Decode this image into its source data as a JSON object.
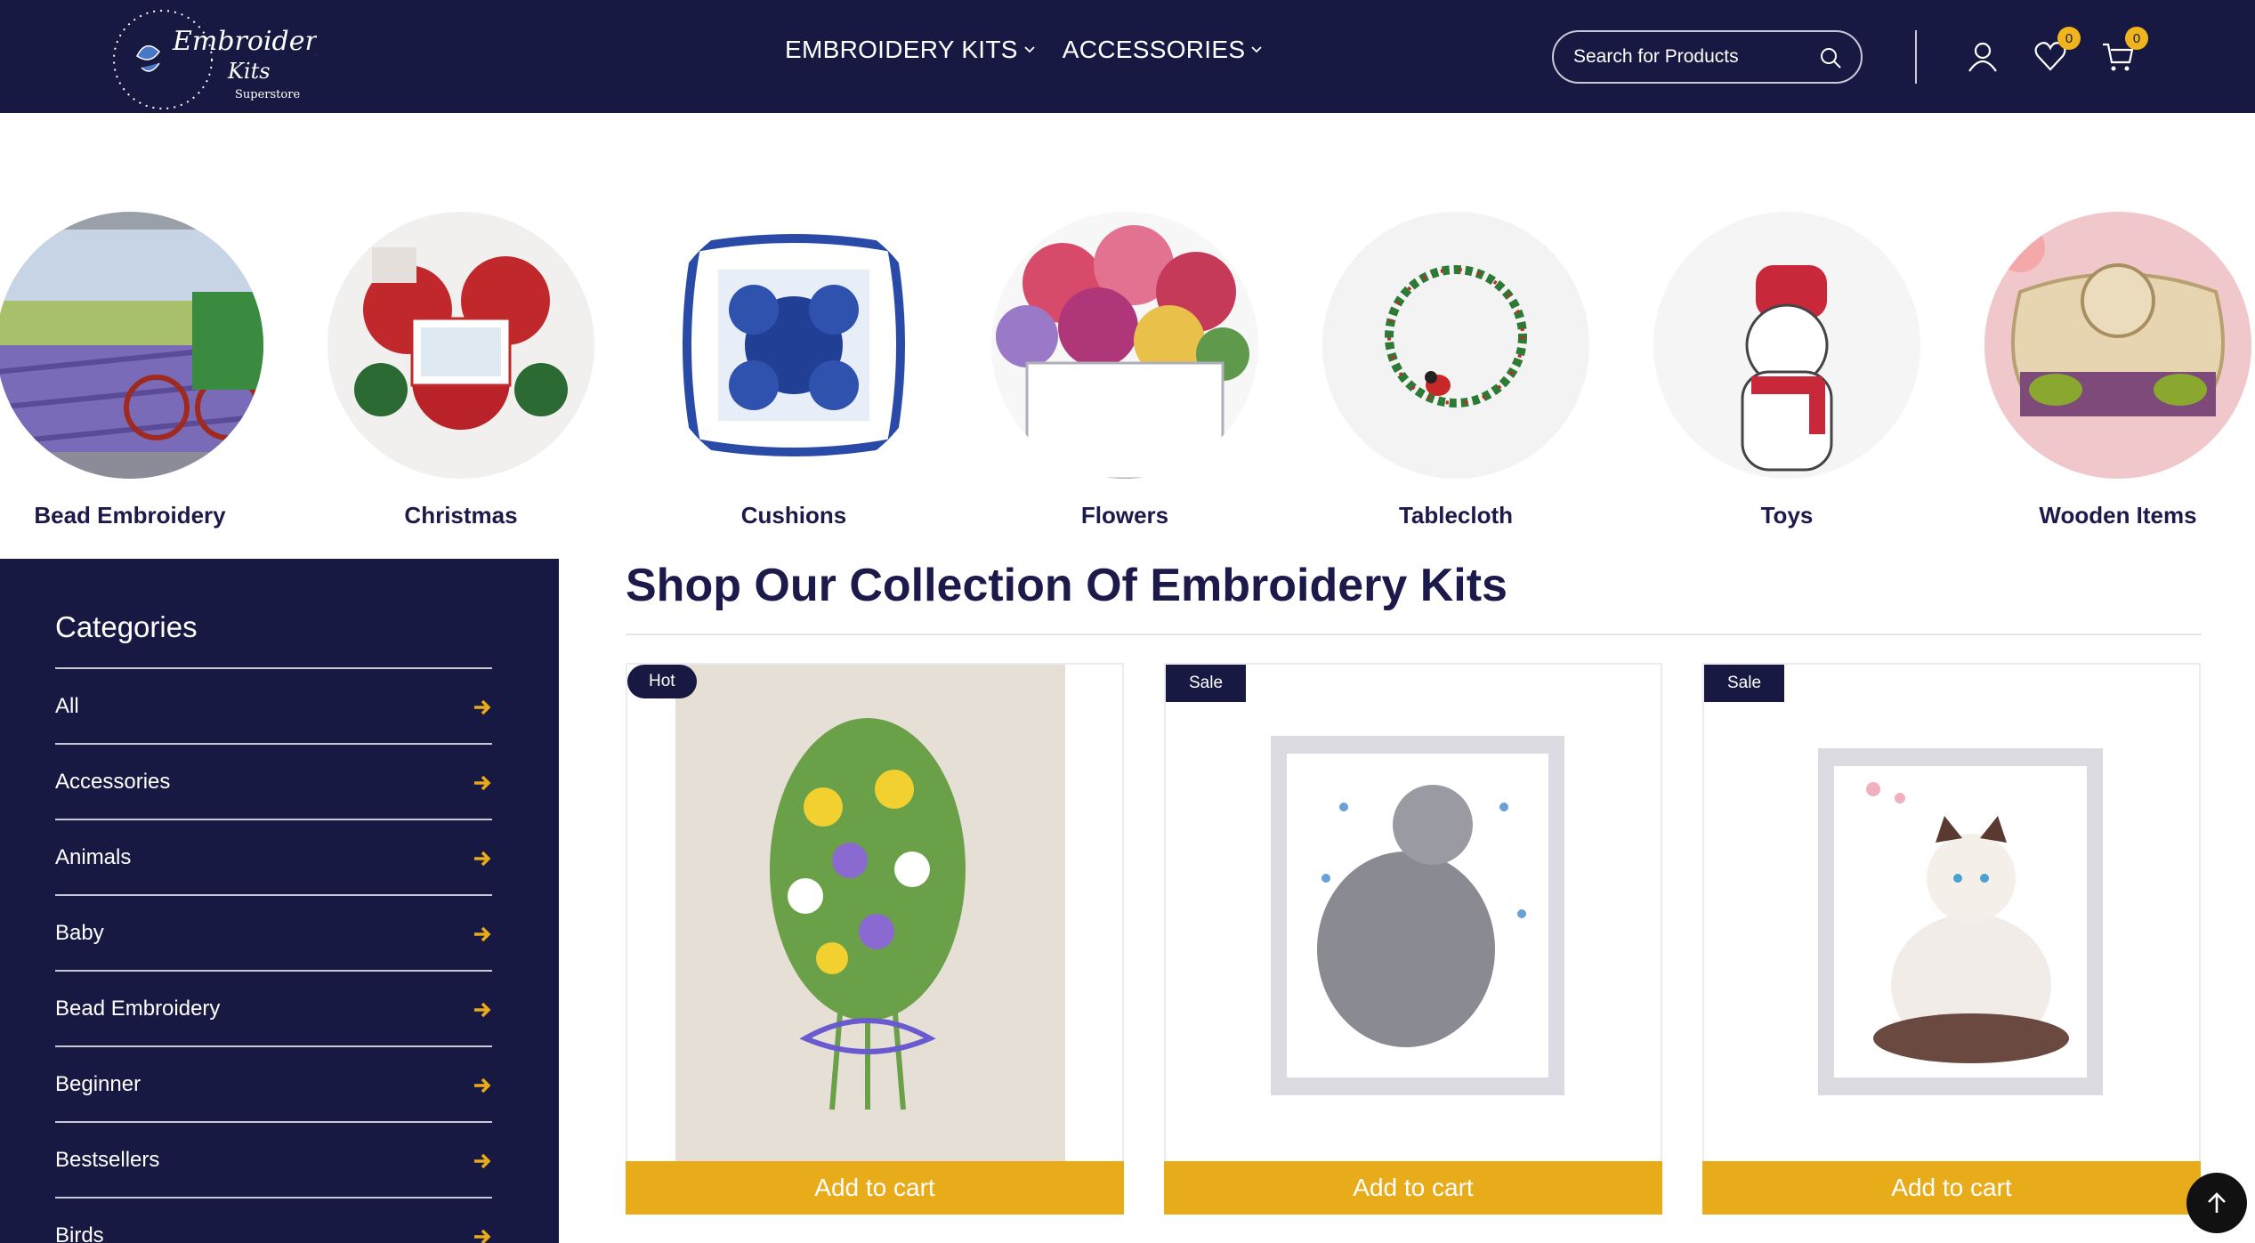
{
  "header": {
    "logo": {
      "line1": "Embroidery",
      "line2": "Kits",
      "line3": "Superstore"
    },
    "nav": [
      {
        "label": "EMBROIDERY KITS"
      },
      {
        "label": "ACCESSORIES"
      }
    ],
    "search": {
      "placeholder": "Search for Products"
    },
    "wishlist_count": "0",
    "cart_count": "0"
  },
  "categories_row": [
    {
      "label": "Bead Embroidery",
      "icon": "bead-embroidery-image"
    },
    {
      "label": "Christmas",
      "icon": "christmas-image"
    },
    {
      "label": "Cushions",
      "icon": "cushions-image"
    },
    {
      "label": "Flowers",
      "icon": "flowers-image"
    },
    {
      "label": "Tablecloth",
      "icon": "tablecloth-image"
    },
    {
      "label": "Toys",
      "icon": "toys-image"
    },
    {
      "label": "Wooden Items",
      "icon": "wooden-items-image"
    }
  ],
  "sidebar": {
    "title": "Categories",
    "items": [
      {
        "label": "All"
      },
      {
        "label": "Accessories"
      },
      {
        "label": "Animals"
      },
      {
        "label": "Baby"
      },
      {
        "label": "Bead Embroidery"
      },
      {
        "label": "Beginner"
      },
      {
        "label": "Bestsellers"
      },
      {
        "label": "Birds"
      }
    ]
  },
  "main": {
    "title": "Shop Our Collection Of Embroidery Kits",
    "products": [
      {
        "tag": "Hot",
        "button": "Add to cart"
      },
      {
        "tag": "Sale",
        "button": "Add to cart"
      },
      {
        "tag": "Sale",
        "button": "Add to cart"
      }
    ]
  },
  "colors": {
    "header_bg": "#181942",
    "accent": "#e8ac1b",
    "badge": "#f0b41c"
  }
}
